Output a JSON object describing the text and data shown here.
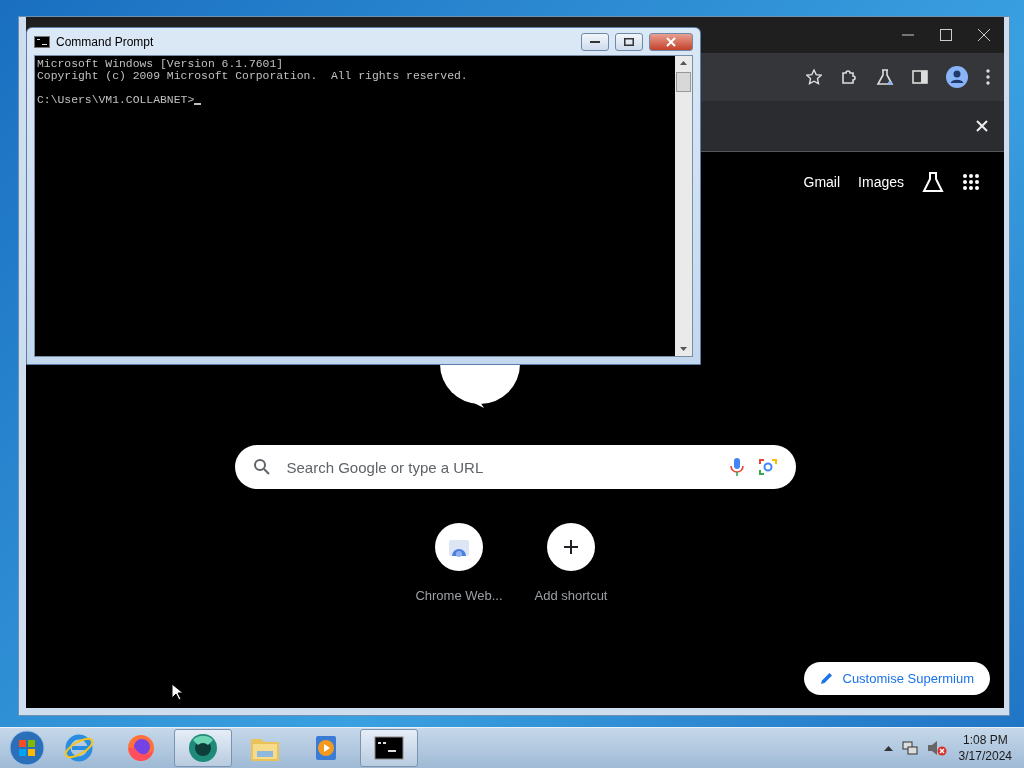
{
  "browser": {
    "header_links": [
      {
        "label": "Gmail"
      },
      {
        "label": "Images"
      }
    ],
    "search": {
      "placeholder": "Search Google or type a URL"
    },
    "shortcuts": [
      {
        "kind": "site",
        "label": "Chrome Web..."
      },
      {
        "kind": "add",
        "label": "Add shortcut"
      }
    ],
    "customise_button": "Customise Supermium"
  },
  "cmd": {
    "title": "Command Prompt",
    "output": [
      "Microsoft Windows [Version 6.1.7601]",
      "Copyright (c) 2009 Microsoft Corporation.  All rights reserved."
    ],
    "prompt": "C:\\Users\\VM1.COLLABNET>"
  },
  "taskbar": {
    "apps": [
      {
        "kind": "ie",
        "selected": false
      },
      {
        "kind": "firefox",
        "selected": false
      },
      {
        "kind": "supermium",
        "selected": true
      },
      {
        "kind": "explorer",
        "selected": false
      },
      {
        "kind": "media",
        "selected": false
      },
      {
        "kind": "cmd",
        "selected": true
      }
    ],
    "time": "1:08 PM",
    "date": "3/17/2024"
  }
}
